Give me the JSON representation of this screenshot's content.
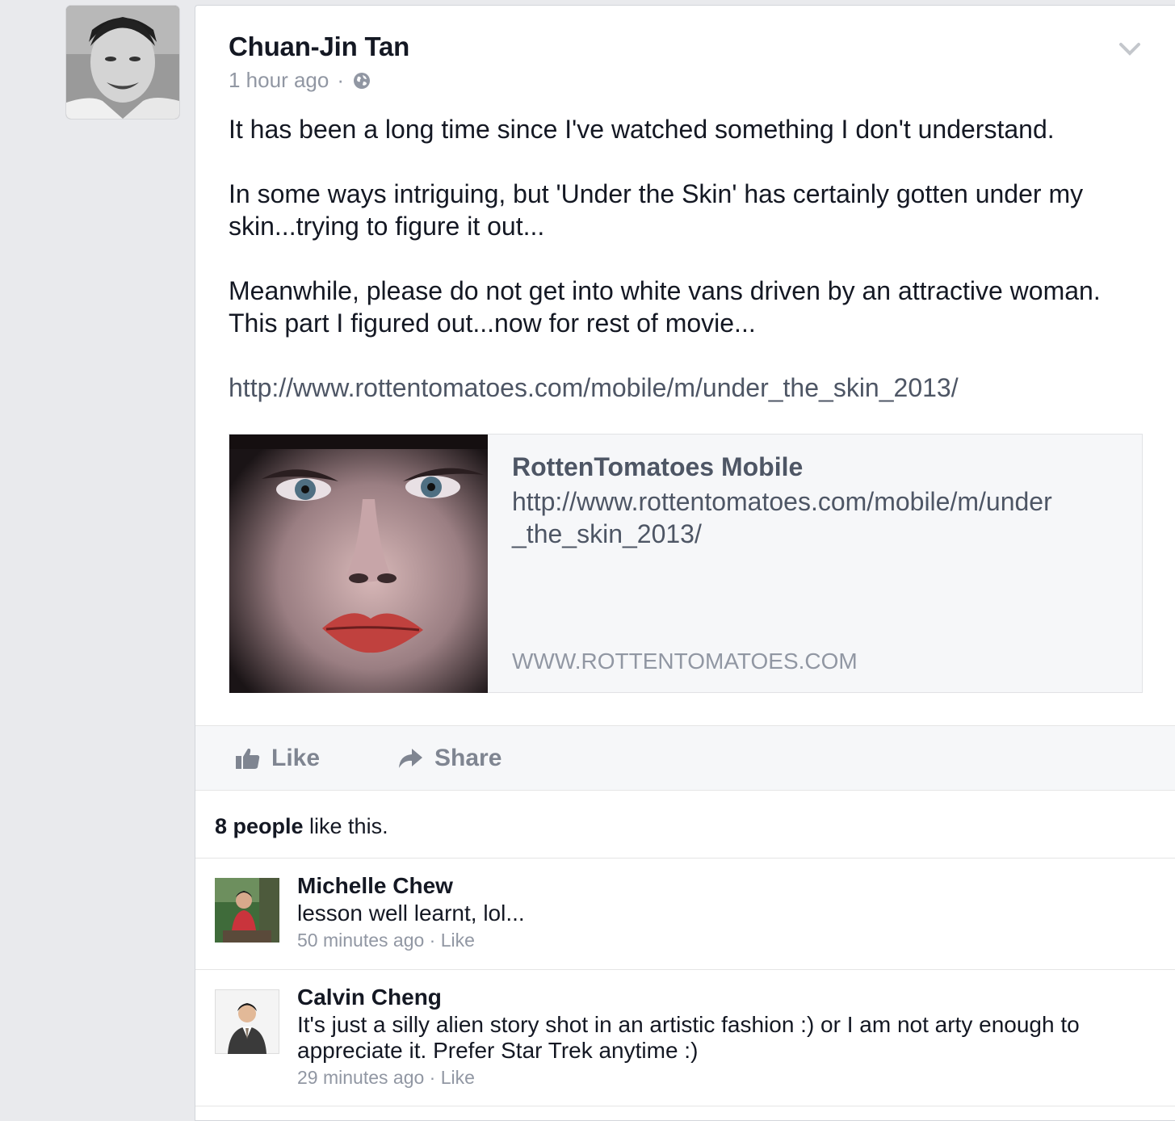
{
  "post": {
    "author": "Chuan-Jin Tan",
    "time": "1 hour ago",
    "separator": "·",
    "paragraphs": [
      "It has been a long time since I've watched something I don't understand.",
      "In some ways intriguing, but 'Under the Skin' has certainly gotten under my skin...trying to figure it out...",
      "Meanwhile, please do not get into white vans driven by an attractive woman. This part I figured out...now for rest of movie..."
    ],
    "link_text": "http://www.rottentomatoes.com/mobile/m/under_the_skin_2013/"
  },
  "link_preview": {
    "title": "RottenTomatoes Mobile",
    "url": "http://www.rottentomatoes.com/mobile/m/under_the_skin_2013/",
    "domain": "WWW.ROTTENTOMATOES.COM"
  },
  "actions": {
    "like_label": "Like",
    "share_label": "Share"
  },
  "likes": {
    "count_text": "8 people",
    "suffix": " like this."
  },
  "comments": [
    {
      "name": "Michelle Chew",
      "text": "lesson well learnt, lol...",
      "time": "50 minutes ago",
      "separator": " · ",
      "like_label": "Like"
    },
    {
      "name": "Calvin Cheng",
      "text": "It's just a silly alien story shot in an artistic fashion :) or I am not arty enough to appreciate it. Prefer Star Trek anytime :)",
      "time": "29 minutes ago",
      "separator": " · ",
      "like_label": "Like"
    }
  ],
  "icons": {
    "privacy": "globe-icon",
    "menu": "chevron-down-icon",
    "like": "thumbs-up-icon",
    "share": "share-arrow-icon"
  },
  "colors": {
    "background": "#e9eaed",
    "text": "#141823",
    "secondary": "#9197a3",
    "link": "#4e5665",
    "action": "#7f8591"
  }
}
